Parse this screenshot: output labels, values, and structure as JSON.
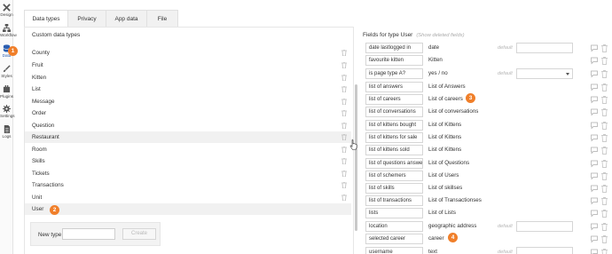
{
  "rail": [
    {
      "label": "Design",
      "icon": "design-icon"
    },
    {
      "label": "Workflow",
      "icon": "workflow-icon"
    },
    {
      "label": "Data",
      "icon": "data-icon"
    },
    {
      "label": "Styles",
      "icon": "styles-icon"
    },
    {
      "label": "Plugins",
      "icon": "plugins-icon"
    },
    {
      "label": "Settings",
      "icon": "settings-icon"
    },
    {
      "label": "Logs",
      "icon": "logs-icon"
    }
  ],
  "tabs": [
    "Data types",
    "Privacy",
    "App data",
    "File manager"
  ],
  "left": {
    "title": "Custom data types",
    "types": [
      "County",
      "Fruit",
      "Kitten",
      "List",
      "Message",
      "Order",
      "Question",
      "Restaurant",
      "Room",
      "Skills",
      "Tickets",
      "Transactions",
      "Unit",
      "User"
    ],
    "new_type_label": "New type",
    "new_type_value": "",
    "create_label": "Create"
  },
  "right": {
    "title": "Fields for type User",
    "hint": "(Show deleted fields)",
    "fields": [
      {
        "name": "date lastlogged in",
        "type": "date",
        "default": "default",
        "control": "box"
      },
      {
        "name": "favourite kitten",
        "type": "Kitten",
        "default": "",
        "control": ""
      },
      {
        "name": "is page type A?",
        "type": "yes / no",
        "default": "default",
        "control": "select"
      },
      {
        "name": "list of answers",
        "type": "List of Answers",
        "default": "",
        "control": ""
      },
      {
        "name": "list of careers",
        "type": "List of careers",
        "default": "",
        "control": ""
      },
      {
        "name": "list of conversations",
        "type": "List of conversations",
        "default": "",
        "control": ""
      },
      {
        "name": "list of kittens bought",
        "type": "List of Kittens",
        "default": "",
        "control": ""
      },
      {
        "name": "list of kittens for sale",
        "type": "List of Kittens",
        "default": "",
        "control": ""
      },
      {
        "name": "list of kittens sold",
        "type": "List of Kittens",
        "default": "",
        "control": ""
      },
      {
        "name": "list of questions answered",
        "type": "List of Questions",
        "default": "",
        "control": ""
      },
      {
        "name": "list of schemers",
        "type": "List of Users",
        "default": "",
        "control": ""
      },
      {
        "name": "list of skills",
        "type": "List of skillses",
        "default": "",
        "control": ""
      },
      {
        "name": "list of transactions",
        "type": "List of Transactionses",
        "default": "",
        "control": ""
      },
      {
        "name": "lists",
        "type": "List of Lists",
        "default": "",
        "control": ""
      },
      {
        "name": "location",
        "type": "geographic address",
        "default": "default",
        "control": "box"
      },
      {
        "name": "selected career",
        "type": "career",
        "default": "",
        "control": ""
      },
      {
        "name": "username",
        "type": "text",
        "default": "default",
        "control": "box"
      }
    ]
  },
  "badges": [
    "1",
    "2",
    "3",
    "4"
  ],
  "colors": {
    "badge": "#f07f2a",
    "accent": "#2a5db0"
  }
}
